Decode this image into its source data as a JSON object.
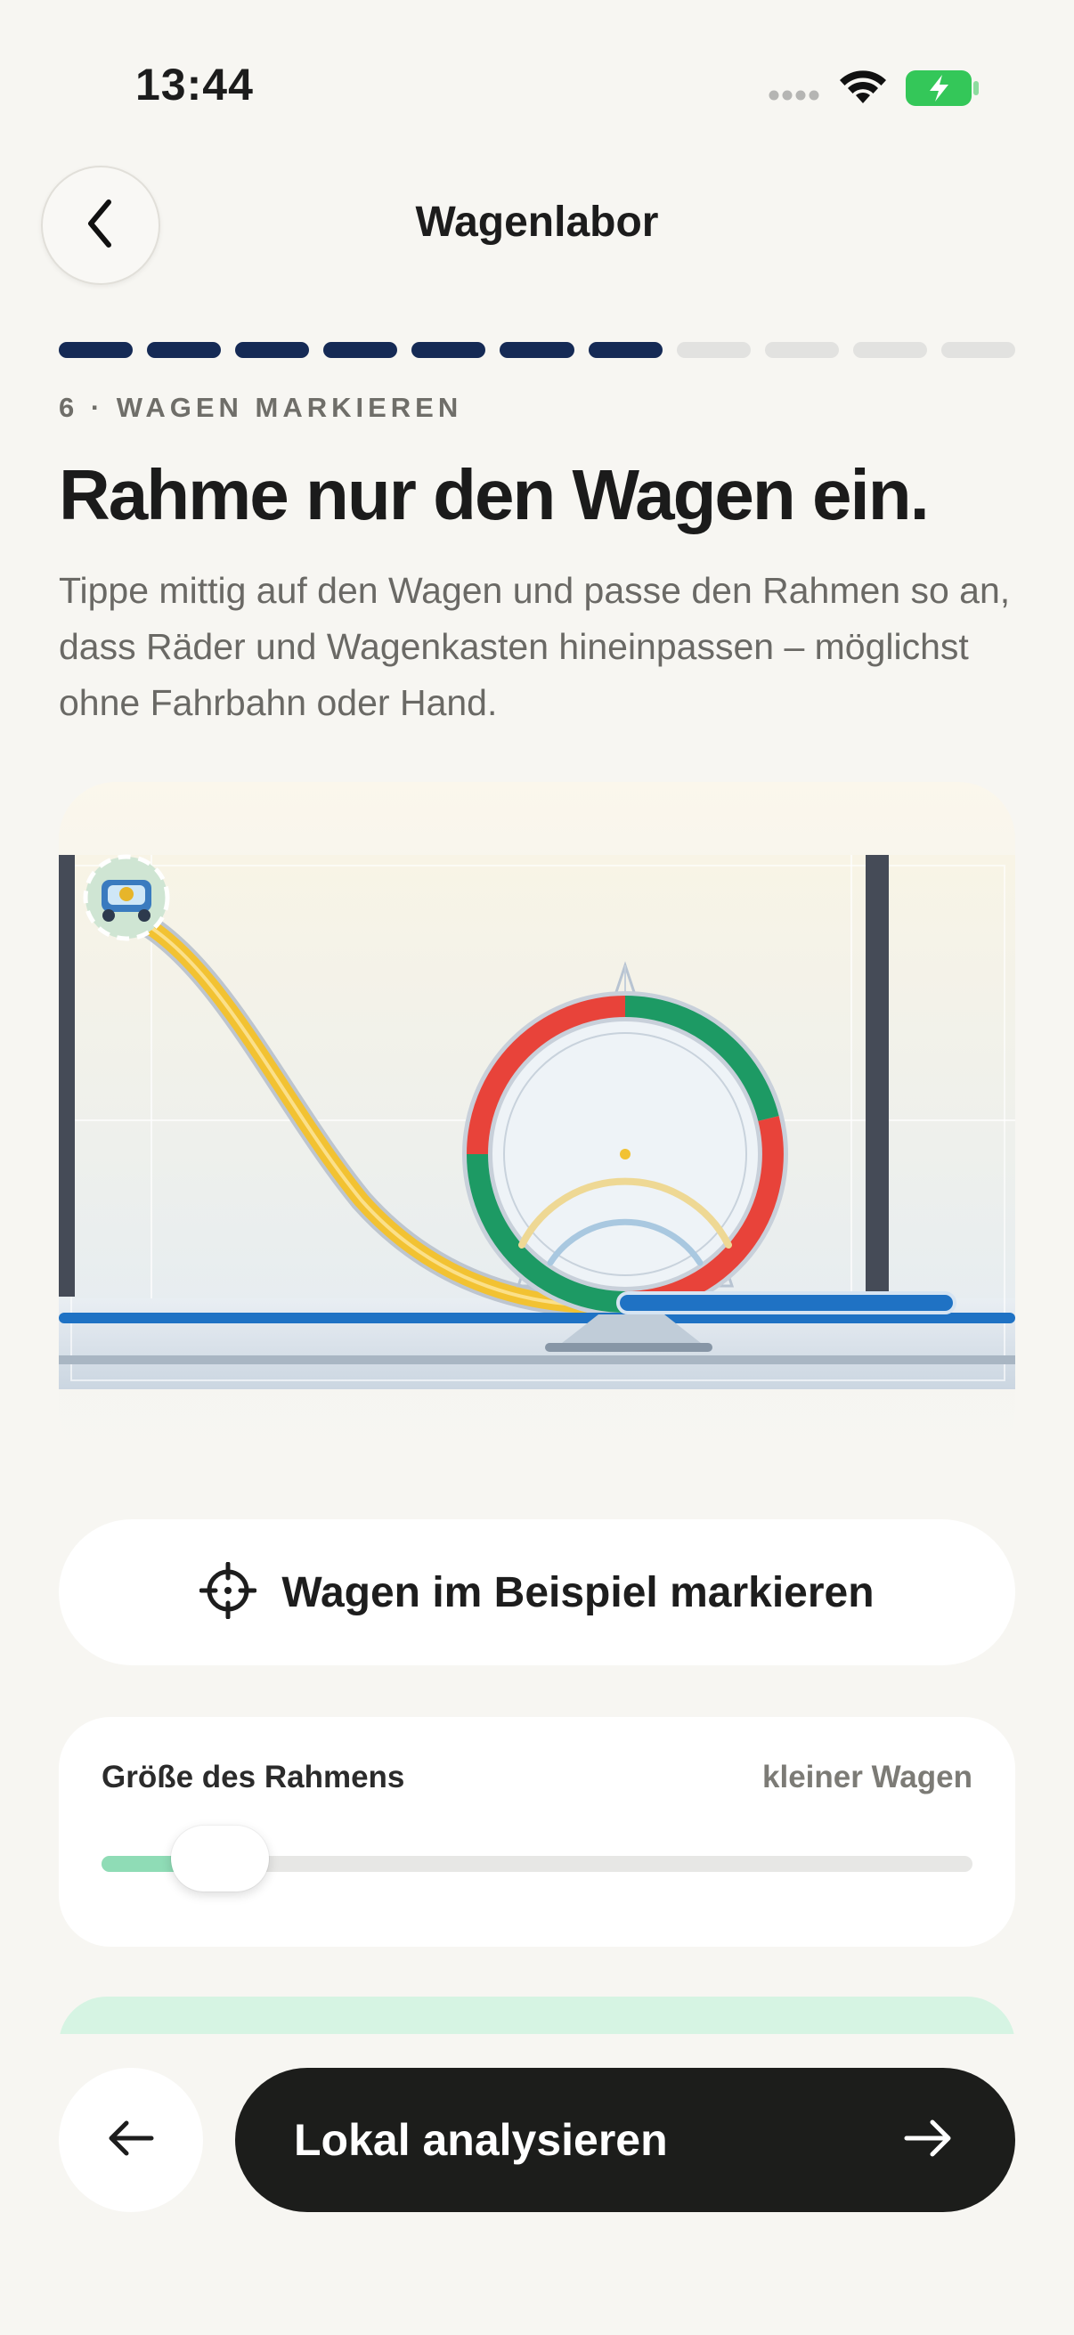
{
  "status_bar": {
    "time": "13:44",
    "icons": [
      "signal-dots-icon",
      "wifi-icon",
      "battery-charging-icon"
    ],
    "battery_color": "#34c759"
  },
  "nav": {
    "title": "Wagenlabor",
    "back_icon": "chevron-left-icon"
  },
  "progress": {
    "total_steps": 11,
    "completed_steps": 7,
    "done_color": "#152a55"
  },
  "step": {
    "label": "6 · WAGEN MARKIEREN",
    "headline": "Rahme nur den Wagen ein.",
    "description": "Tippe mittig auf den Wagen und passe den Rahmen so an, dass Räder und Wagenkasten hineinpassen – möglichst ohne Fahrbahn oder Hand."
  },
  "example_image": {
    "subject": "coaster-track-illustration",
    "colors": {
      "ramp": "#f2c232",
      "loop_red": "#e8433a",
      "loop_green": "#1d9a64",
      "exit_track": "#1f72c4"
    }
  },
  "mark_button": {
    "label": "Wagen im Beispiel markieren",
    "icon": "crosshair-icon"
  },
  "frame_size": {
    "label": "Größe des Rahmens",
    "value_label": "kleiner Wagen",
    "slider_value": 0.08,
    "fill_color": "#8fdcb6"
  },
  "footer": {
    "back_icon": "arrow-left-icon",
    "primary_label": "Lokal analysieren",
    "primary_icon": "arrow-right-icon"
  }
}
